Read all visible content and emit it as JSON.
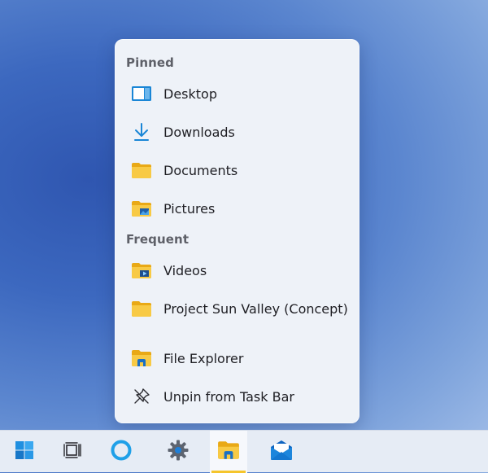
{
  "jumplist": {
    "pinned_header": "Pinned",
    "pinned": [
      {
        "label": "Desktop",
        "icon": "desktop-icon"
      },
      {
        "label": "Downloads",
        "icon": "download-arrow-icon"
      },
      {
        "label": "Documents",
        "icon": "folder-icon"
      },
      {
        "label": "Pictures",
        "icon": "pictures-folder-icon"
      }
    ],
    "frequent_header": "Frequent",
    "frequent": [
      {
        "label": "Videos",
        "icon": "videos-folder-icon"
      },
      {
        "label": "Project Sun Valley (Concept)",
        "icon": "folder-icon"
      }
    ],
    "actions": [
      {
        "label": "File Explorer",
        "icon": "file-explorer-icon"
      },
      {
        "label": "Unpin from Task Bar",
        "icon": "unpin-icon"
      }
    ]
  },
  "taskbar": {
    "items": [
      {
        "icon": "windows-start-icon",
        "active": false
      },
      {
        "icon": "task-view-icon",
        "active": false
      },
      {
        "icon": "cortana-circle-icon",
        "active": false
      },
      {
        "icon": "settings-gear-icon",
        "active": false
      },
      {
        "icon": "file-explorer-icon",
        "active": true
      },
      {
        "icon": "mail-icon",
        "active": false
      }
    ]
  },
  "colors": {
    "accent_blue": "#1a86d6",
    "folder_yellow": "#f5c52c",
    "active_indicator": "#f5c52c"
  }
}
